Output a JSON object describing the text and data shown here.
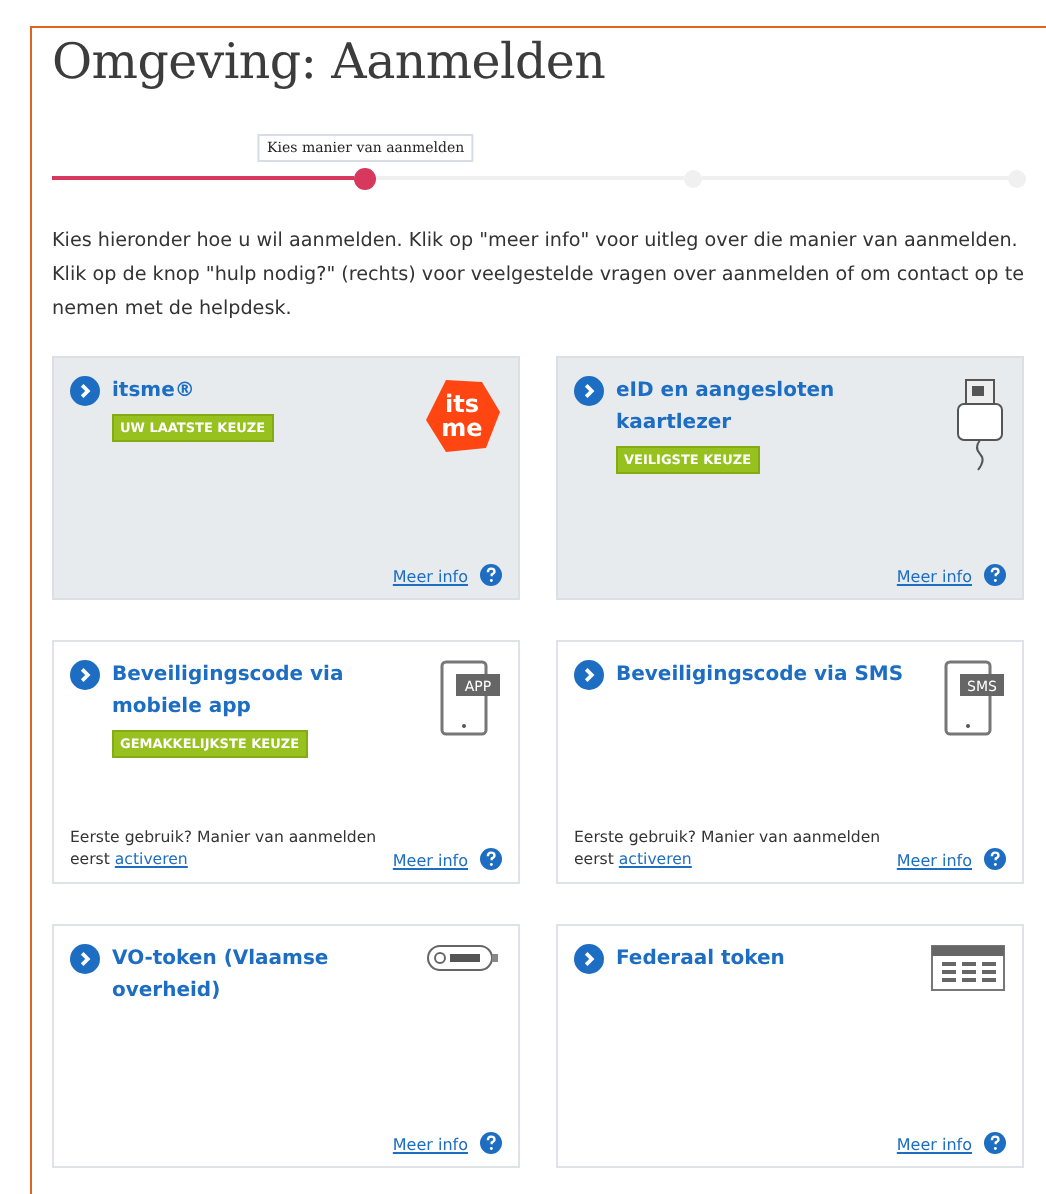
{
  "page": {
    "title": "Omgeving: Aanmelden"
  },
  "stepper": {
    "steps": [
      {
        "selected": true,
        "tooltip": "Kies manier van aanmelden"
      },
      {
        "selected": false
      },
      {
        "selected": false
      }
    ]
  },
  "intro": "Kies hieronder hoe u wil aanmelden. Klik op \"meer info\" voor uitleg over die manier van aanmelden. Klik op de knop \"hulp nodig?\" (rechts) voor veelgestelde vragen over aanmelden of om contact op te nemen met de helpdesk.",
  "methods": [
    {
      "title": "itsme®",
      "badge": "UW LAATSTE KEUZE",
      "highlighted": true,
      "icon": {
        "kind": "itsme",
        "lines": [
          "its",
          "me"
        ]
      },
      "link": "Meer info"
    },
    {
      "title": "eID en aangesloten kaartlezer",
      "badge": "VEILIGSTE KEUZE",
      "highlighted": true,
      "icon": {
        "kind": "card-reader"
      },
      "link": "Meer info"
    },
    {
      "title": "Beveiligingscode via mobiele app",
      "badge": "GEMAKKELIJKSTE KEUZE",
      "highlighted": false,
      "icon": {
        "kind": "phone",
        "label": "APP"
      },
      "note": "Eerste gebruik? Manier van aanmelden eerst",
      "note_link": "activeren",
      "link": "Meer info"
    },
    {
      "title": "Beveiligingscode via SMS",
      "highlighted": false,
      "icon": {
        "kind": "phone",
        "label": "SMS"
      },
      "note": "Eerste gebruik? Manier van aanmelden eerst",
      "note_link": "activeren",
      "link": "Meer info"
    },
    {
      "title": "VO-token (Vlaamse overheid)",
      "highlighted": false,
      "icon": {
        "kind": "usb-token"
      },
      "link": "Meer info"
    },
    {
      "title": "Federaal token",
      "highlighted": false,
      "icon": {
        "kind": "token-grid"
      },
      "link": "Meer info"
    }
  ]
}
